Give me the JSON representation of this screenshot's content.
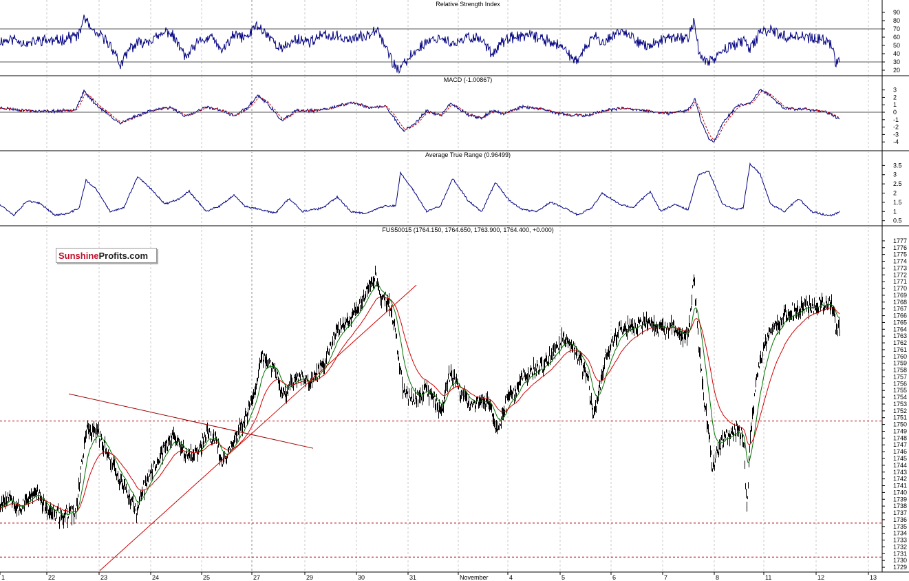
{
  "watermark": {
    "part1": "Sunshine",
    "part2": "Profits.com"
  },
  "chart_data": [
    {
      "type": "line",
      "title": "Relative Strength Index",
      "ylim": [
        15,
        95
      ],
      "yticks": [
        20,
        30,
        40,
        50,
        60,
        70,
        80,
        90
      ],
      "reference_lines": [
        30,
        70
      ],
      "seed": 11,
      "x": [
        0,
        20,
        40,
        60,
        80,
        100,
        115,
        122,
        135,
        150,
        165,
        175,
        190,
        210,
        230,
        245,
        260,
        270,
        290,
        310,
        320,
        340,
        360,
        372,
        390,
        410,
        430,
        450,
        470,
        490,
        510,
        530,
        548,
        560,
        570,
        580,
        600,
        620,
        640,
        660,
        680,
        700,
        715,
        730,
        760,
        780,
        800,
        820,
        840,
        860,
        880,
        900,
        920,
        940,
        960,
        980,
        1000,
        1008,
        1015,
        1025,
        1040,
        1060,
        1080,
        1090,
        1105,
        1120,
        1140,
        1160,
        1180,
        1200,
        1210,
        1215,
        1220
      ],
      "values": [
        55,
        58,
        52,
        57,
        55,
        60,
        62,
        85,
        65,
        60,
        45,
        25,
        48,
        55,
        60,
        68,
        50,
        35,
        55,
        60,
        42,
        62,
        60,
        75,
        62,
        45,
        58,
        55,
        62,
        60,
        58,
        60,
        72,
        50,
        30,
        20,
        40,
        55,
        60,
        50,
        60,
        58,
        40,
        55,
        62,
        60,
        55,
        45,
        30,
        60,
        55,
        68,
        60,
        48,
        55,
        60,
        58,
        82,
        45,
        28,
        35,
        50,
        55,
        45,
        65,
        70,
        60,
        62,
        58,
        55,
        50,
        28,
        35
      ],
      "series": [
        {
          "color": "#000080"
        }
      ],
      "grid": true
    },
    {
      "type": "line",
      "title": "MACD (-1.00867)",
      "ylim": [
        -5,
        3.8
      ],
      "yticks": [
        3,
        2,
        1,
        0,
        -1,
        -2,
        -3,
        -4
      ],
      "reference_lines": [
        0
      ],
      "seed": 23,
      "x": [
        0,
        30,
        60,
        90,
        110,
        122,
        140,
        160,
        175,
        190,
        220,
        250,
        270,
        300,
        320,
        340,
        360,
        375,
        390,
        410,
        430,
        460,
        490,
        510,
        540,
        560,
        575,
        585,
        600,
        620,
        640,
        655,
        680,
        700,
        715,
        730,
        760,
        790,
        820,
        850,
        880,
        910,
        940,
        970,
        1000,
        1010,
        1020,
        1030,
        1037,
        1050,
        1070,
        1090,
        1105,
        1120,
        1140,
        1170,
        1200,
        1210,
        1220
      ],
      "values": [
        0.6,
        0.3,
        0.1,
        0.2,
        0.4,
        2.8,
        1.0,
        -0.5,
        -1.5,
        -0.8,
        0.3,
        0.6,
        -0.6,
        0.7,
        0.3,
        -0.5,
        0.6,
        2.3,
        1.0,
        -1.2,
        0.2,
        0.2,
        0.8,
        1.3,
        0.6,
        0.8,
        -1.0,
        -2.5,
        -1.8,
        0.2,
        -0.5,
        1.2,
        -0.3,
        -0.8,
        0.2,
        -0.2,
        0.8,
        0.3,
        -0.3,
        -0.5,
        0.3,
        0.5,
        0.2,
        -0.2,
        0.3,
        1.8,
        -1.5,
        -3.5,
        -4.0,
        -1.5,
        0.8,
        1.2,
        3.0,
        2.2,
        0.5,
        0.4,
        0.1,
        -0.4,
        -1.0
      ],
      "series": [
        {
          "color": "#000080"
        },
        {
          "color": "#c00000",
          "dashed": true
        }
      ],
      "grid": true
    },
    {
      "type": "line",
      "title": "Average True Range (0.96499)",
      "ylim": [
        0.3,
        3.85
      ],
      "yticks": [
        3.5,
        3.0,
        2.5,
        2.0,
        1.5,
        1.0,
        0.5
      ],
      "reference_lines": [],
      "seed": 37,
      "x": [
        0,
        20,
        40,
        60,
        80,
        100,
        115,
        125,
        140,
        160,
        180,
        200,
        220,
        240,
        260,
        275,
        300,
        320,
        340,
        355,
        380,
        400,
        420,
        440,
        470,
        490,
        510,
        530,
        560,
        575,
        582,
        600,
        620,
        640,
        658,
        680,
        700,
        720,
        740,
        760,
        780,
        800,
        820,
        840,
        860,
        875,
        900,
        920,
        945,
        960,
        980,
        1000,
        1015,
        1030,
        1050,
        1070,
        1080,
        1090,
        1105,
        1120,
        1140,
        1160,
        1180,
        1200,
        1210,
        1220
      ],
      "values": [
        1.4,
        0.8,
        1.6,
        1.4,
        0.8,
        0.9,
        1.2,
        2.7,
        2.2,
        1.0,
        1.2,
        2.9,
        2.2,
        1.4,
        1.7,
        2.1,
        1.0,
        1.3,
        1.9,
        1.3,
        1.1,
        0.9,
        1.7,
        1.0,
        1.2,
        1.8,
        1.0,
        0.9,
        1.3,
        1.3,
        3.1,
        2.2,
        1.0,
        1.3,
        2.8,
        1.6,
        1.0,
        2.6,
        1.6,
        1.1,
        1.0,
        1.5,
        1.2,
        0.8,
        1.2,
        2.0,
        1.4,
        1.2,
        2.1,
        1.0,
        1.4,
        1.1,
        3.0,
        3.2,
        1.4,
        1.1,
        1.2,
        3.6,
        3.0,
        1.4,
        1.0,
        1.7,
        1.0,
        0.8,
        0.8,
        1.0
      ],
      "series": [
        {
          "color": "#000080"
        }
      ],
      "grid": true
    },
    {
      "type": "line",
      "title": "FUS50015 (1764.150, 1764.650, 1763.900, 1764.400, +0.000)",
      "ylim": [
        1728.5,
        1778
      ],
      "yticks": [
        1777,
        1776,
        1775,
        1774,
        1773,
        1772,
        1771,
        1770,
        1769,
        1768,
        1767,
        1766,
        1765,
        1764,
        1763,
        1762,
        1761,
        1760,
        1759,
        1758,
        1757,
        1756,
        1755,
        1754,
        1753,
        1752,
        1751,
        1750,
        1749,
        1748,
        1747,
        1746,
        1745,
        1744,
        1743,
        1742,
        1741,
        1740,
        1739,
        1738,
        1737,
        1736,
        1735,
        1734,
        1733,
        1732,
        1731,
        1730,
        1729
      ],
      "xtick_labels": [
        "1",
        "22",
        "23",
        "24",
        "25",
        "27",
        "29",
        "30",
        "31",
        "November",
        "4",
        "5",
        "6",
        "7",
        "8",
        "11",
        "12",
        "13"
      ],
      "xtick_pos": [
        0,
        68,
        144,
        219,
        293,
        366,
        443,
        518,
        593,
        666,
        738,
        814,
        888,
        963,
        1038,
        1110,
        1186,
        1262
      ],
      "reference_lines": [
        1750.5,
        1735.5,
        1730.5
      ],
      "seed": 53,
      "x": [
        0,
        15,
        30,
        50,
        70,
        90,
        110,
        118,
        125,
        140,
        160,
        175,
        190,
        198,
        210,
        230,
        250,
        270,
        285,
        300,
        315,
        322,
        340,
        355,
        370,
        380,
        400,
        410,
        430,
        450,
        470,
        490,
        510,
        530,
        545,
        552,
        565,
        575,
        582,
        590,
        600,
        620,
        640,
        655,
        670,
        690,
        710,
        722,
        735,
        760,
        780,
        800,
        820,
        840,
        855,
        862,
        880,
        900,
        920,
        940,
        960,
        980,
        1000,
        1008,
        1015,
        1025,
        1035,
        1050,
        1070,
        1080,
        1085,
        1090,
        1100,
        1120,
        1140,
        1160,
        1180,
        1200,
        1210,
        1215,
        1220
      ],
      "values": [
        1738.5,
        1739.5,
        1737.5,
        1740.5,
        1737.0,
        1736.5,
        1737.0,
        1744.0,
        1749.0,
        1749.0,
        1745.0,
        1741.5,
        1739.0,
        1737.0,
        1741.0,
        1745.0,
        1748.5,
        1746.0,
        1745.5,
        1749.0,
        1747.5,
        1744.0,
        1748.0,
        1750.5,
        1755.0,
        1760.0,
        1758.0,
        1754.0,
        1757.0,
        1756.0,
        1759.0,
        1764.0,
        1766.0,
        1769.0,
        1772.0,
        1769.0,
        1768.0,
        1763.0,
        1757.0,
        1754.0,
        1754.0,
        1755.0,
        1752.0,
        1758.0,
        1754.0,
        1753.0,
        1753.5,
        1749.0,
        1753.0,
        1757.0,
        1758.0,
        1760.0,
        1763.0,
        1760.0,
        1756.0,
        1751.0,
        1760.0,
        1764.0,
        1764.5,
        1765.0,
        1764.0,
        1764.0,
        1763.0,
        1772.0,
        1762.0,
        1752.0,
        1744.0,
        1748.0,
        1749.0,
        1748.0,
        1738.0,
        1748.0,
        1758.0,
        1764.0,
        1766.0,
        1767.0,
        1767.5,
        1768.0,
        1767.0,
        1764.0,
        1764.4
      ],
      "series": [
        {
          "name": "",
          "color": "#000000"
        },
        {
          "color": "#007000"
        },
        {
          "color": "#d00000"
        }
      ],
      "trendlines": [
        {
          "from": [
            100,
            1754.5
          ],
          "to": [
            455,
            1746.5
          ],
          "color": "#a00000"
        },
        {
          "from": [
            145,
            1728.5
          ],
          "to": [
            605,
            1770.5
          ],
          "color": "#d00000"
        }
      ],
      "grid": true
    }
  ]
}
